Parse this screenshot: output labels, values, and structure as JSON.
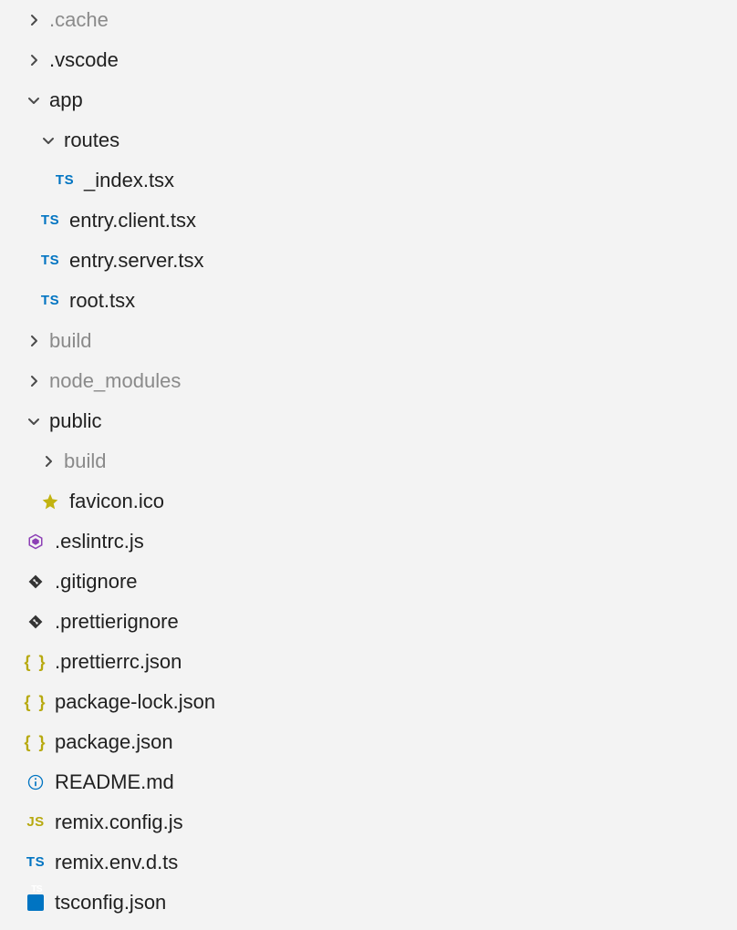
{
  "tree": {
    "cache": ".cache",
    "vscode": ".vscode",
    "app": "app",
    "routes": "routes",
    "index_tsx": "_index.tsx",
    "entry_client": "entry.client.tsx",
    "entry_server": "entry.server.tsx",
    "root_tsx": "root.tsx",
    "build": "build",
    "node_modules": "node_modules",
    "public": "public",
    "public_build": "build",
    "favicon": "favicon.ico",
    "eslintrc": ".eslintrc.js",
    "gitignore": ".gitignore",
    "prettierignore": ".prettierignore",
    "prettierrc": ".prettierrc.json",
    "package_lock": "package-lock.json",
    "package_json": "package.json",
    "readme": "README.md",
    "remix_config": "remix.config.js",
    "remix_env": "remix.env.d.ts",
    "tsconfig": "tsconfig.json"
  },
  "icons": {
    "ts": "TS",
    "js": "JS",
    "json": "{ }",
    "tsconf": "TS"
  }
}
